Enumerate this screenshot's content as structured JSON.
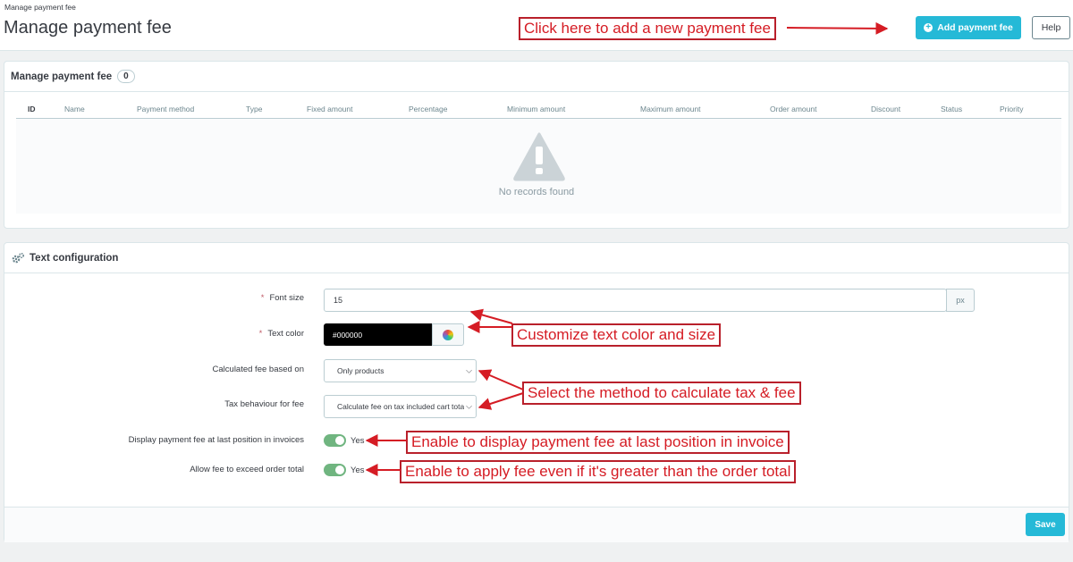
{
  "header": {
    "breadcrumb": "Manage payment fee",
    "title": "Manage payment fee",
    "add_button": "Add payment fee",
    "help_button": "Help"
  },
  "list_panel": {
    "title": "Manage payment fee",
    "count": "0",
    "columns": [
      "ID",
      "Name",
      "Payment method",
      "Type",
      "Fixed amount",
      "Percentage",
      "Minimum amount",
      "Maximum amount",
      "Order amount",
      "Discount",
      "Status",
      "Priority"
    ],
    "empty_text": "No records found"
  },
  "config_panel": {
    "title": "Text configuration",
    "font_size": {
      "label": "Font size",
      "value": "15",
      "unit": "px"
    },
    "text_color": {
      "label": "Text color",
      "value": "#000000"
    },
    "fee_based_on": {
      "label": "Calculated fee based on",
      "value": "Only products"
    },
    "tax_behaviour": {
      "label": "Tax behaviour for fee",
      "value": "Calculate fee on tax included cart total"
    },
    "last_position": {
      "label": "Display payment fee at last position in invoices",
      "value": "Yes"
    },
    "exceed_total": {
      "label": "Allow fee to exceed order total",
      "value": "Yes"
    },
    "save_button": "Save"
  },
  "annotations": {
    "add_fee": "Click here to add a new payment fee",
    "text_color_size": "Customize text color and size",
    "calc_method": "Select the method to calculate tax & fee",
    "last_position": "Enable to display payment fee at last position in invoice",
    "exceed_total": "Enable to apply fee even if it's greater than the order total"
  },
  "colors": {
    "primary": "#25b9d7",
    "toggle_on": "#70b580",
    "annotation": "#d51c24",
    "background": "#eff1f2"
  }
}
